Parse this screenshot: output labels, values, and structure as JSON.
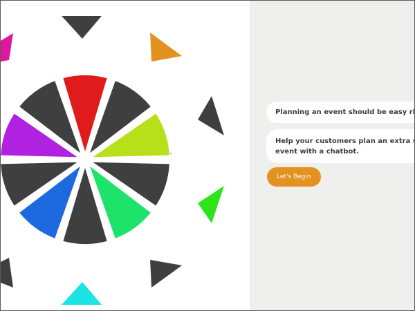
{
  "colors": {
    "panel_bg": "#efefed",
    "bubble_bg": "#ffffff",
    "button": "#e3921f",
    "dark_wedge": "#3f3f3f"
  },
  "wheel": {
    "wedges": [
      "red",
      "dark",
      "yellow-green",
      "dark",
      "green",
      "dark",
      "blue",
      "dark",
      "purple",
      "dark"
    ],
    "palette": {
      "red": "#e01b1b",
      "dark": "#3f3f3f",
      "yellow-green": "#b8e01a",
      "green": "#1ee36a",
      "blue": "#1d6ae0",
      "purple": "#b021e0"
    }
  },
  "triangles": [
    "dark",
    "orange",
    "magenta",
    "dark",
    "green",
    "dark",
    "dark",
    "cyan"
  ],
  "chat": {
    "messages": [
      "Planning an event should be easy right?",
      "Help your customers plan an extra special event with a chatbot."
    ],
    "begin_label": "Let's Begin"
  }
}
